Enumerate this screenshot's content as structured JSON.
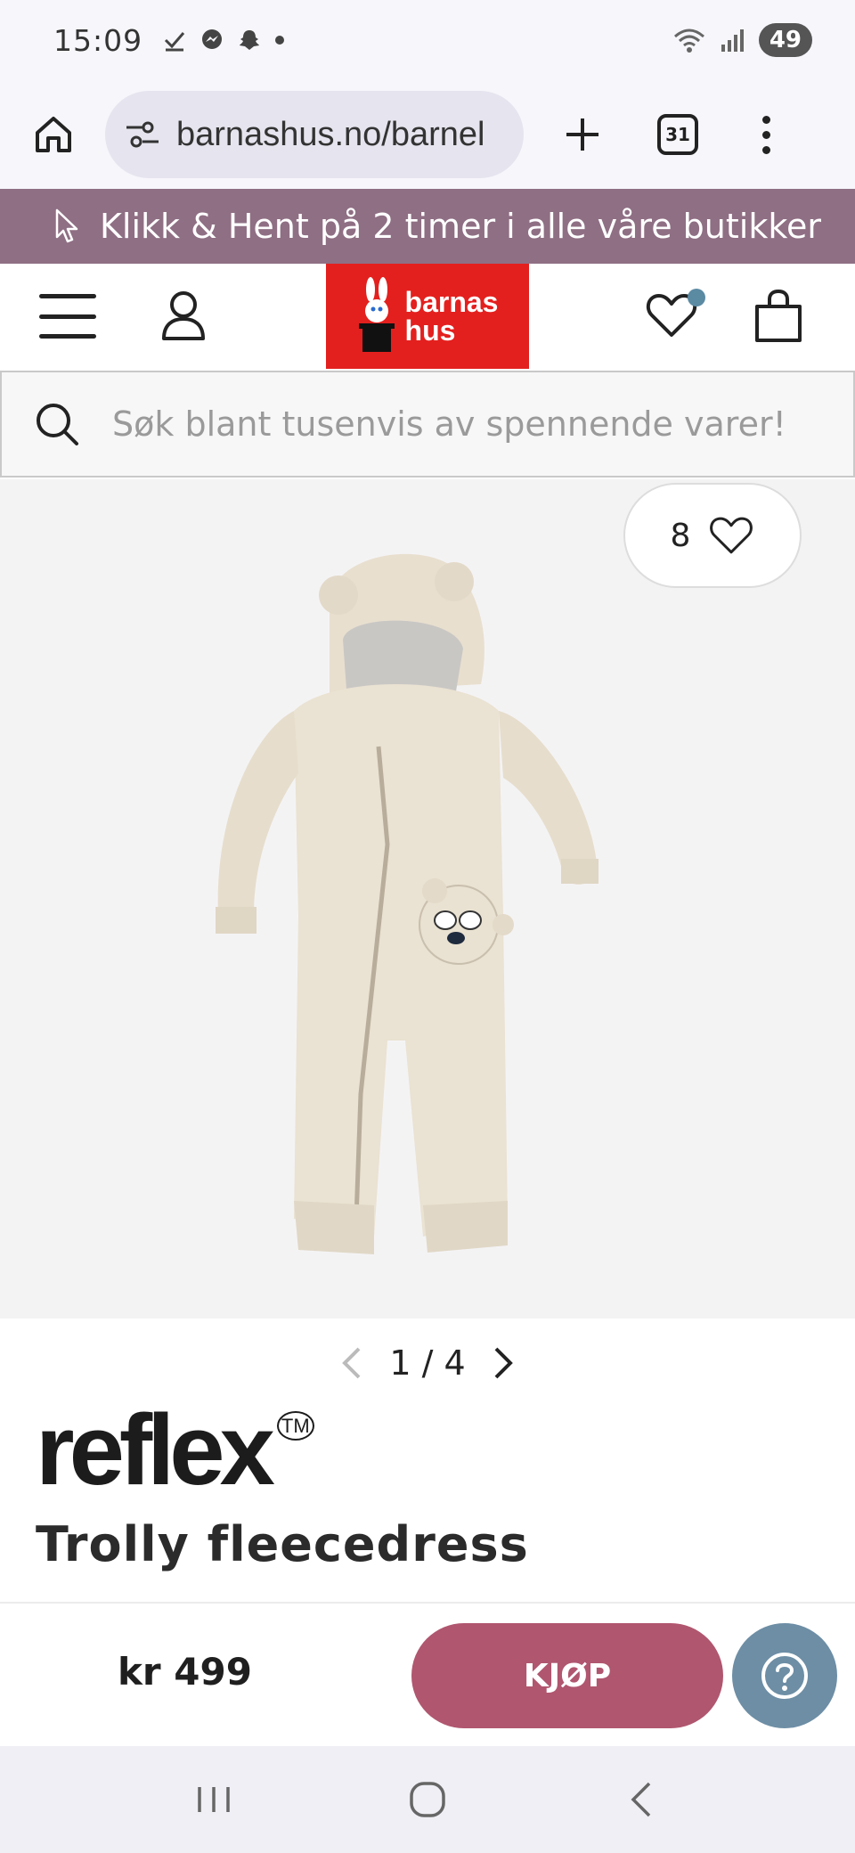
{
  "status_bar": {
    "time": "15:09",
    "battery": "49"
  },
  "browser": {
    "url": "barnashus.no/barnel",
    "tab_count": "31"
  },
  "promo_banner": {
    "text": "Klikk & Hent på 2 timer i alle våre butikker"
  },
  "header": {
    "logo_line1": "barnas",
    "logo_line2": "hus"
  },
  "search": {
    "placeholder": "Søk blant tusenvis av spennende varer!"
  },
  "product": {
    "favorite_count": "8",
    "image_pager": "1 / 4",
    "brand": "reflex",
    "brand_mark": "TM",
    "title": "Trolly fleecedress",
    "price": "kr 499",
    "buy_label": "KJØP"
  },
  "colors": {
    "promo_bg": "#8f6f84",
    "logo_bg": "#e3201e",
    "buy_button": "#b0566f",
    "help_button": "#6d8ea5"
  }
}
